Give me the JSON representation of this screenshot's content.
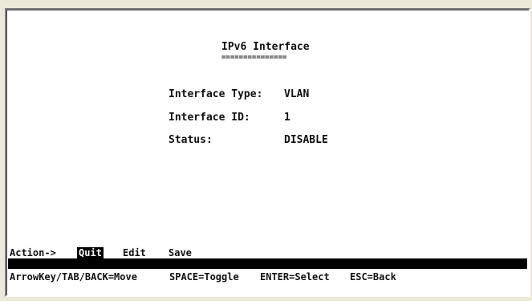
{
  "screen": {
    "title": "IPv6 Interface",
    "title_underline": "==============="
  },
  "fields": [
    {
      "label": "Interface Type:",
      "value": "VLAN"
    },
    {
      "label": "Interface ID:",
      "value": "1"
    },
    {
      "label": "Status:",
      "value": "DISABLE"
    }
  ],
  "action_bar": {
    "prompt": "Action->",
    "items": [
      {
        "label": "Quit",
        "selected": true
      },
      {
        "label": "Edit",
        "selected": false
      },
      {
        "label": "Save",
        "selected": false
      }
    ]
  },
  "help_bar": {
    "items": [
      "ArrowKey/TAB/BACK=Move",
      "SPACE=Toggle",
      "ENTER=Select",
      "ESC=Back"
    ]
  },
  "colors": {
    "background": "#ffffff",
    "text": "#101010",
    "selected_bg": "#000000",
    "selected_fg": "#ffffff",
    "window_frame": "#ece9d8"
  }
}
